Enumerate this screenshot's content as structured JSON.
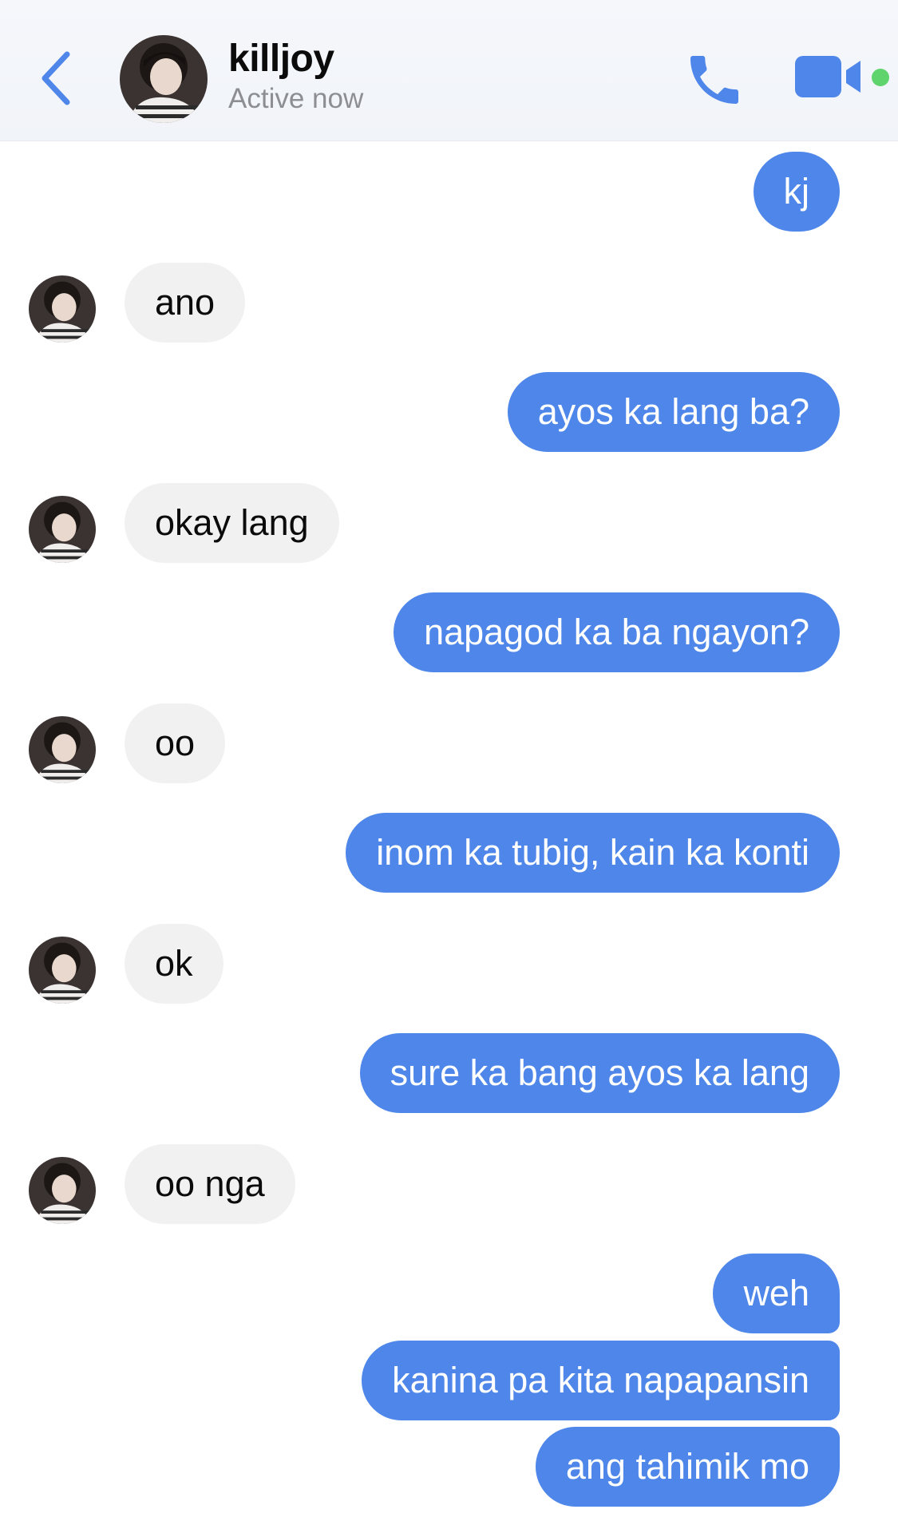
{
  "header": {
    "contact_name": "killjoy",
    "status": "Active now",
    "accent_color": "#4e86ea",
    "online_dot_color": "#5fd36c",
    "icons": [
      "back-chevron-icon",
      "avatar",
      "phone-icon",
      "video-camera-icon",
      "online-dot"
    ]
  },
  "messages": [
    {
      "side": "out",
      "text": "kj"
    },
    {
      "side": "in",
      "text": "ano"
    },
    {
      "side": "out",
      "text": "ayos ka lang ba?"
    },
    {
      "side": "in",
      "text": "okay lang"
    },
    {
      "side": "out",
      "text": "napagod ka ba ngayon?"
    },
    {
      "side": "in",
      "text": "oo"
    },
    {
      "side": "out",
      "text": "inom ka tubig, kain ka konti"
    },
    {
      "side": "in",
      "text": "ok"
    },
    {
      "side": "out",
      "text": "sure ka bang ayos ka lang"
    },
    {
      "side": "in",
      "text": "oo nga"
    },
    {
      "side": "out",
      "text": "weh"
    },
    {
      "side": "out",
      "text": "kanina pa kita napapansin"
    },
    {
      "side": "out",
      "text": "ang tahimik mo"
    }
  ],
  "colors": {
    "outgoing_bubble": "#4e86ea",
    "incoming_bubble": "#f1f1f2",
    "outgoing_text": "#ffffff",
    "incoming_text": "#0b0b0b"
  }
}
